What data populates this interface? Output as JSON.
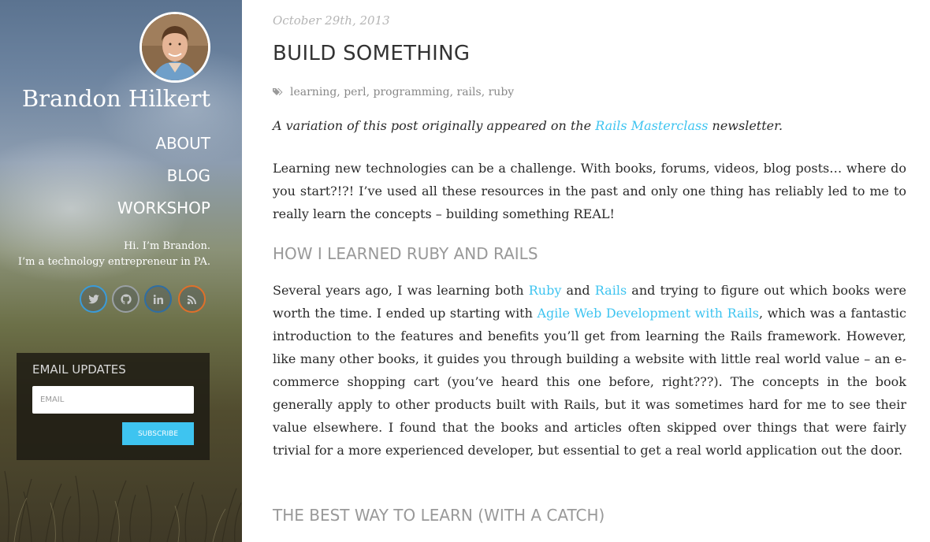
{
  "sidebar": {
    "name": "Brandon Hilkert",
    "nav": [
      {
        "label": "ABOUT"
      },
      {
        "label": "BLOG"
      },
      {
        "label": "WORKSHOP"
      }
    ],
    "bio_line1": "Hi. I’m Brandon.",
    "bio_line2": "I’m a technology entrepreneur in PA.",
    "social": [
      {
        "icon": "twitter-icon",
        "color": "#3a9bd9"
      },
      {
        "icon": "github-icon",
        "color": "#9aa0a4"
      },
      {
        "icon": "linkedin-icon",
        "color": "#2f6ea3"
      },
      {
        "icon": "rss-icon",
        "color": "#e0702a"
      }
    ],
    "email": {
      "title": "EMAIL UPDATES",
      "placeholder": "EMAIL",
      "button": "SUBSCRIBE"
    }
  },
  "post": {
    "date": "October 29th, 2013",
    "title": "BUILD SOMETHING",
    "tags": [
      "learning",
      "perl",
      "programming",
      "rails",
      "ruby"
    ],
    "intro": {
      "before": "A variation of this post originally appeared on the ",
      "link": "Rails Masterclass",
      "after": " newsletter."
    },
    "p1": "Learning new technologies can be a challenge. With books, forums, videos, blog posts… where do you start?!?! I’ve used all these resources in the past and only one thing has reliably led to me to really learn the concepts – building something REAL!",
    "h2a": "HOW I LEARNED RUBY AND RAILS",
    "p2": {
      "t1": "Several years ago, I was learning both ",
      "l1": "Ruby",
      "t2": " and ",
      "l2": "Rails",
      "t3": " and trying to figure out which books were worth the time. I ended up starting with ",
      "l3": "Agile Web Development with Rails",
      "t4": ", which was a fantastic introduction to the features and benefits you’ll get from learning the Rails framework. However, like many other books, it guides you through building a website with little real world value – an e-commerce shopping cart (you’ve heard this one before, right???). The concepts in the book generally apply to other products built with Rails, but it was sometimes hard for me to see their value elsewhere. I found that the books and articles often skipped over things that were fairly trivial for a more experienced developer, but essential to get a real world application out the door."
    },
    "h2b": "THE BEST WAY TO LEARN (WITH A CATCH)"
  },
  "colors": {
    "link": "#3ec4f0",
    "subscribe": "#3ec4f0"
  }
}
